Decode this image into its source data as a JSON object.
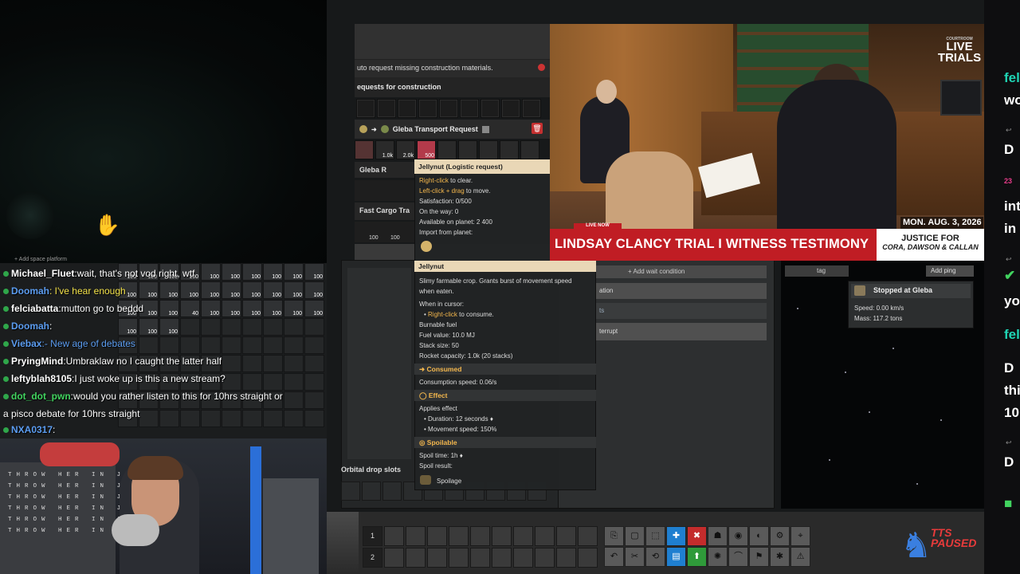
{
  "factorio": {
    "auto_request": "uto request missing construction materials.",
    "requests_title": "equests for construction",
    "gleba_transport": "Gleba Transport Request",
    "gleba_r": "Gleba R",
    "fast_cargo": "Fast Cargo Tra",
    "items": [
      "1.0k",
      "2.0k",
      "500"
    ],
    "row3": [
      "100",
      "100"
    ],
    "orbital_drop": "Orbital drop slots",
    "add_space_platform": "+ Add space platform",
    "add_wait": "+ Add wait condition",
    "row_nation": "ation",
    "row_ts": "ts",
    "row_interrupt": "terrupt",
    "tag": "tag",
    "add_ping": "Add ping",
    "stopped": "Stopped at Gleba",
    "speed": "Speed: 0.00 km/s",
    "mass": "Mass: 117.2 tons"
  },
  "inventory": {
    "cells": [
      "100",
      "100",
      "100",
      "100",
      "100",
      "100",
      "100",
      "100",
      "100",
      "100",
      "100",
      "100",
      "100",
      "100",
      "100",
      "100",
      "100",
      "100",
      "100",
      "100",
      "100",
      "100",
      "100",
      "40",
      "100",
      "100",
      "100",
      "100",
      "100",
      "100",
      "100",
      "100",
      "100"
    ]
  },
  "tooltip": {
    "title": "Jellynut (Logistic request)",
    "l1_a": "Right-click",
    "l1_b": " to clear.",
    "l2_a": "Left-click + drag",
    "l2_b": " to move.",
    "l3": "Satisfaction: 0/500",
    "l4": "On the way: 0",
    "l5": "Available on planet: 2 400",
    "l6": "Import from planet:",
    "section": "Jellynut",
    "desc1": "Slimy farmable crop. Grants burst of movement speed",
    "desc2": "when eaten.",
    "cursor": "When in cursor:",
    "cursor_a": "Right-click",
    "cursor_b": " to consume.",
    "burnable": "Burnable fuel",
    "fuel": "Fuel value: 10.0 MJ",
    "stack": "Stack size: 50",
    "rocket": "Rocket capacity: 1.0k (20 stacks)",
    "consumed": "Consumed",
    "cons_speed": "Consumption speed: 0.06/s",
    "effect": "Effect",
    "applies": "Applies effect",
    "duration": "Duration: 12 seconds ♦",
    "movement": "Movement speed: 150%",
    "spoilable": "Spoilable",
    "spoil_time": "Spoil time: 1h ♦",
    "spoil_result": "Spoil result:",
    "spoilage": "Spoilage"
  },
  "hotbar": {
    "row_nums": [
      "1",
      "2"
    ]
  },
  "broadcast": {
    "logo_small": "COURTROOM",
    "logo_big": "LIVE\nTRIALS",
    "date": "MON. AUG. 3, 2026",
    "live_now": "LIVE NOW",
    "banner": "LINDSAY CLANCY TRIAL I WITNESS TESTIMONY",
    "justice_1": "JUSTICE FOR",
    "justice_2": "CORA, DAWSON & CALLAN"
  },
  "chat": {
    "messages": [
      {
        "user": "Michael_Fluet",
        "text": ":wait, that's not vod right, wtf",
        "color": "#ffffff"
      },
      {
        "user": "Doomah",
        "text": ": I've hear enough",
        "color": "#5b9cf0",
        "textcolor": "#f3e24a"
      },
      {
        "user": "felciabatta",
        "text": ":mutton go to beddd",
        "color": "#ffffff"
      },
      {
        "user": "Doomah",
        "text": ":",
        "color": "#5b9cf0"
      },
      {
        "user": "Viebax",
        "text": ":- New age of debates",
        "color": "#5b9cf0",
        "textcolor": "#5b9cf0"
      },
      {
        "user": "PryingMind",
        "text": ":Umbraklaw no I caught the latter half",
        "color": "#ffffff"
      },
      {
        "user": "leftyblah8105",
        "text": ":I just woke up is this a new stream?",
        "color": "#ffffff"
      },
      {
        "user": "dot_dot_pwn",
        "text": ":would you rather listen to this for 10hrs straight or",
        "color": "#41d35f"
      },
      {
        "user": "",
        "text": "a pisco debate for 10hrs straight",
        "color": "#ffffff"
      },
      {
        "user": "NXA0317",
        "text": ":",
        "color": "#5b9cf0"
      }
    ]
  },
  "wall_text": "THROW HER IN JAIL",
  "right_chat": {
    "t1": "fel",
    "t2": "wo",
    "t3": "D",
    "t4": "23",
    "t5": "int",
    "t6": "in",
    "t7": "yo",
    "t8": "fel",
    "t9": "D",
    "t10": "thi",
    "t11": "10",
    "t12": "D"
  },
  "tts": {
    "line1": "TTS",
    "line2": "PAUSED"
  }
}
